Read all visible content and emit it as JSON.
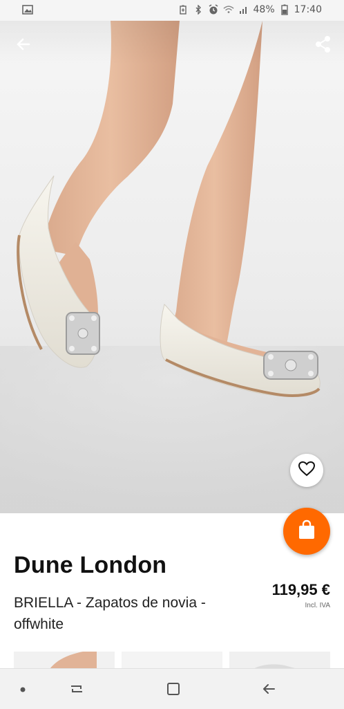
{
  "status_bar": {
    "battery_percent": "48%",
    "time": "17:40",
    "icons": [
      "image-icon",
      "battery-saver-icon",
      "bluetooth-icon",
      "alarm-icon",
      "wifi-icon",
      "signal-icon",
      "battery-icon"
    ]
  },
  "header": {
    "back_icon": "arrow-left-icon",
    "share_icon": "share-icon"
  },
  "product": {
    "brand": "Dune London",
    "name": "BRIELLA - Zapatos de novia - offwhite",
    "price": "119,95 €",
    "vat_note": "Incl. IVA",
    "wishlist_icon": "heart-outline-icon",
    "cart_icon": "shopping-bag-icon"
  },
  "colors": {
    "accent": "#ff6900",
    "nav_bar": "#f2f2f2"
  },
  "nav_bar": {
    "icons": [
      "dot-icon",
      "recent-apps-icon",
      "home-icon",
      "back-icon"
    ]
  }
}
